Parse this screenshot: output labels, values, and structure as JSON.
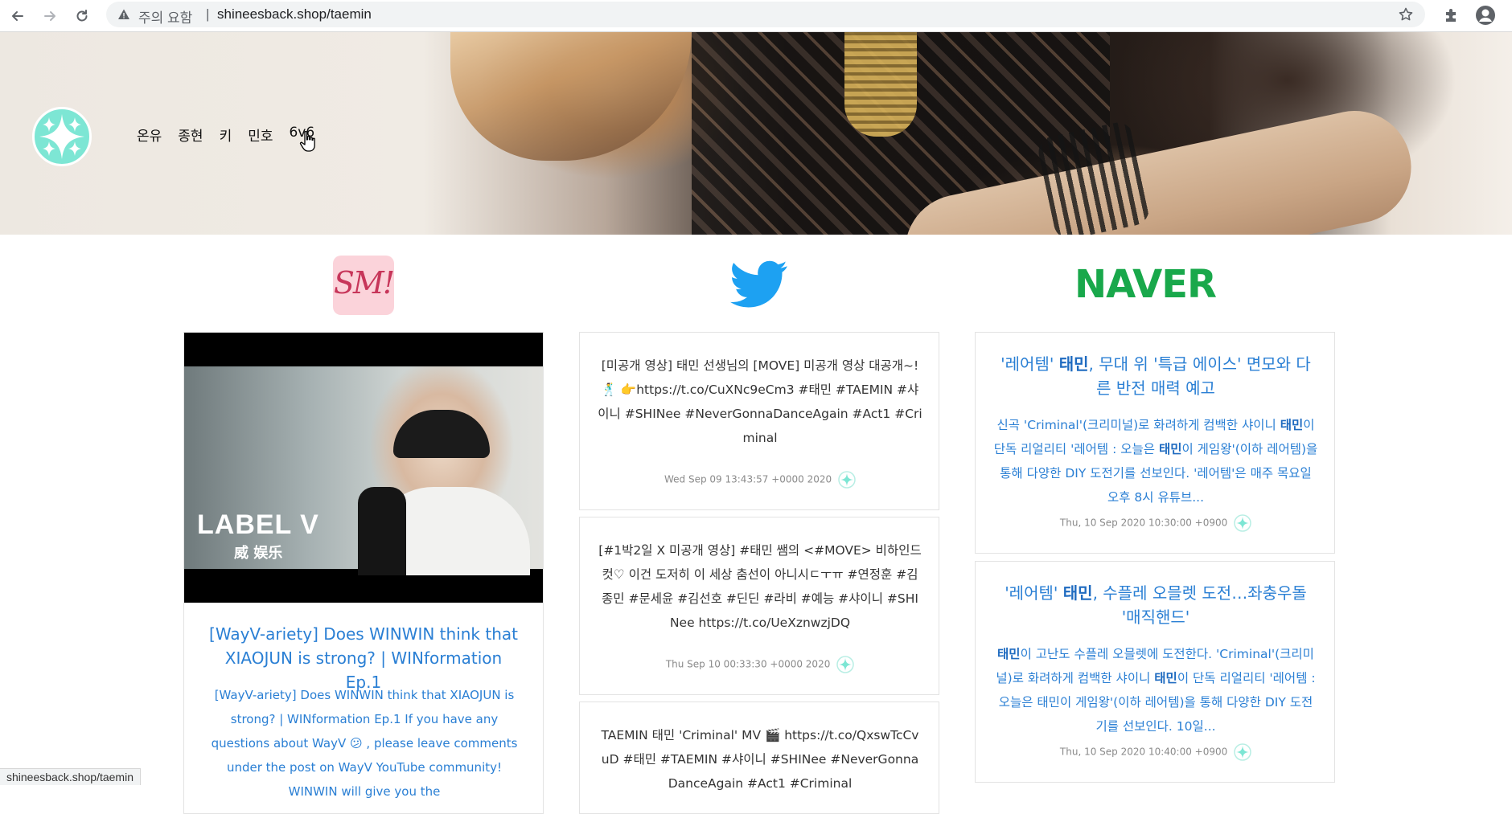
{
  "browser": {
    "security_label": "주의 요함",
    "separator": "|",
    "url": "shineesback.shop/taemin",
    "status_url": "shineesback.shop/taemin"
  },
  "hero": {
    "nav": [
      "온유",
      "종현",
      "키",
      "민호",
      "6v6"
    ]
  },
  "headers": {
    "naver": "NAVER",
    "sm": "SM!"
  },
  "youtube": {
    "thumb_label": "LABEL V",
    "thumb_sub": "威 娱乐",
    "title": "[WayV-ariety] Does WINWIN think that XIAOJUN is strong? | WINformation Ep.1",
    "description": "[WayV-ariety] Does WINWIN think that XIAOJUN is strong? | WINformation Ep.1 If you have any questions about WayV 😕 , please leave comments under the post on WayV YouTube community! WINWIN will give you the"
  },
  "tweets": [
    {
      "text": "[미공개 영상] 태민 선생님의 [MOVE] 미공개 영상 대공개~!🕺 👉https://t.co/CuXNc9eCm3 #태민 #TAEMIN #샤이니 #SHINee #NeverGonnaDanceAgain #Act1 #Criminal",
      "date": "Wed Sep 09 13:43:57 +0000 2020"
    },
    {
      "text": "[#1박2일 X 미공개 영상] #태민 쌤의 <#MOVE> 비하인드컷♡ 이건 도저히 이 세상 춤선이 아니시ㄷㅜㅠ #연정훈 #김종민 #문세윤 #김선호 #딘딘 #라비 #예능 #샤이니 #SHINee https://t.co/UeXznwzjDQ",
      "date": "Thu Sep 10 00:33:30 +0000 2020"
    },
    {
      "text": "TAEMIN 태민 'Criminal' MV 🎬 https://t.co/QxswTcCvuD #태민 #TAEMIN #샤이니 #SHINee #NeverGonnaDanceAgain #Act1 #Criminal"
    }
  ],
  "news": [
    {
      "title_a": "'레어템' ",
      "title_b": "태민",
      "title_c": ", 무대 위 '특급 에이스' 면모와 다른 반전 매력 예고",
      "text_a": "신곡 'Criminal'(크리미널)로 화려하게 컴백한 샤이니 ",
      "text_b": "태민",
      "text_c": "이 단독 리얼리티 '레어템 : 오늘은 ",
      "text_d": "태민",
      "text_e": "이 게임왕'(이하 레어템)을 통해 다양한 DIY 도전기를 선보인다. '레어템'은 매주 목요일 오후 8시 유튜브...",
      "date": "Thu, 10 Sep 2020 10:30:00 +0900"
    },
    {
      "title_a": "'레어템' ",
      "title_b": "태민",
      "title_c": ", 수플레 오믈렛 도전…좌충우돌 '매직핸드'",
      "text_a": "",
      "text_b": "태민",
      "text_c": "이 고난도 수플레 오믈렛에 도전한다. 'Criminal'(크리미널)로 화려하게 컴백한 샤이니 ",
      "text_d": "태민",
      "text_e": "이 단독 리얼리티 '레어템 : 오늘은 태민이 게임왕'(이하 레어템)을 통해 다양한 DIY 도전기를 선보인다. 10일...",
      "date": "Thu, 10 Sep 2020 10:40:00 +0900"
    }
  ],
  "colors": {
    "link_blue": "#2a7fd4",
    "naver_green": "#19a84b",
    "logo_mint": "#7de6d4",
    "sm_pink": "#fbd3da",
    "twitter_blue": "#1da1f2"
  }
}
